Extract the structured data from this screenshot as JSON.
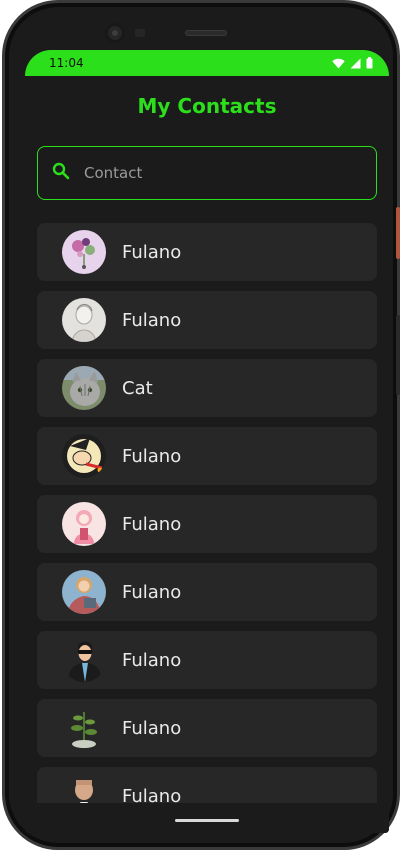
{
  "status_bar": {
    "time": "11:04",
    "icons": [
      "wifi-icon",
      "signal-icon",
      "battery-icon"
    ]
  },
  "header": {
    "title": "My Contacts"
  },
  "search": {
    "placeholder": "Contact",
    "value": ""
  },
  "contacts": [
    {
      "name": "Fulano",
      "avatar": "flowers-avatar"
    },
    {
      "name": "Fulano",
      "avatar": "sketch-avatar"
    },
    {
      "name": "Cat",
      "avatar": "cat-avatar"
    },
    {
      "name": "Fulano",
      "avatar": "witch-avatar"
    },
    {
      "name": "Fulano",
      "avatar": "pink-cartoon-avatar"
    },
    {
      "name": "Fulano",
      "avatar": "woman-cartoon-avatar"
    },
    {
      "name": "Fulano",
      "avatar": "man-sunglasses-avatar"
    },
    {
      "name": "Fulano",
      "avatar": "plant-avatar"
    },
    {
      "name": "Fulano",
      "avatar": "man-avatar"
    }
  ],
  "colors": {
    "accent": "#2be01a",
    "background": "#1b1b1b",
    "card": "#272727"
  }
}
